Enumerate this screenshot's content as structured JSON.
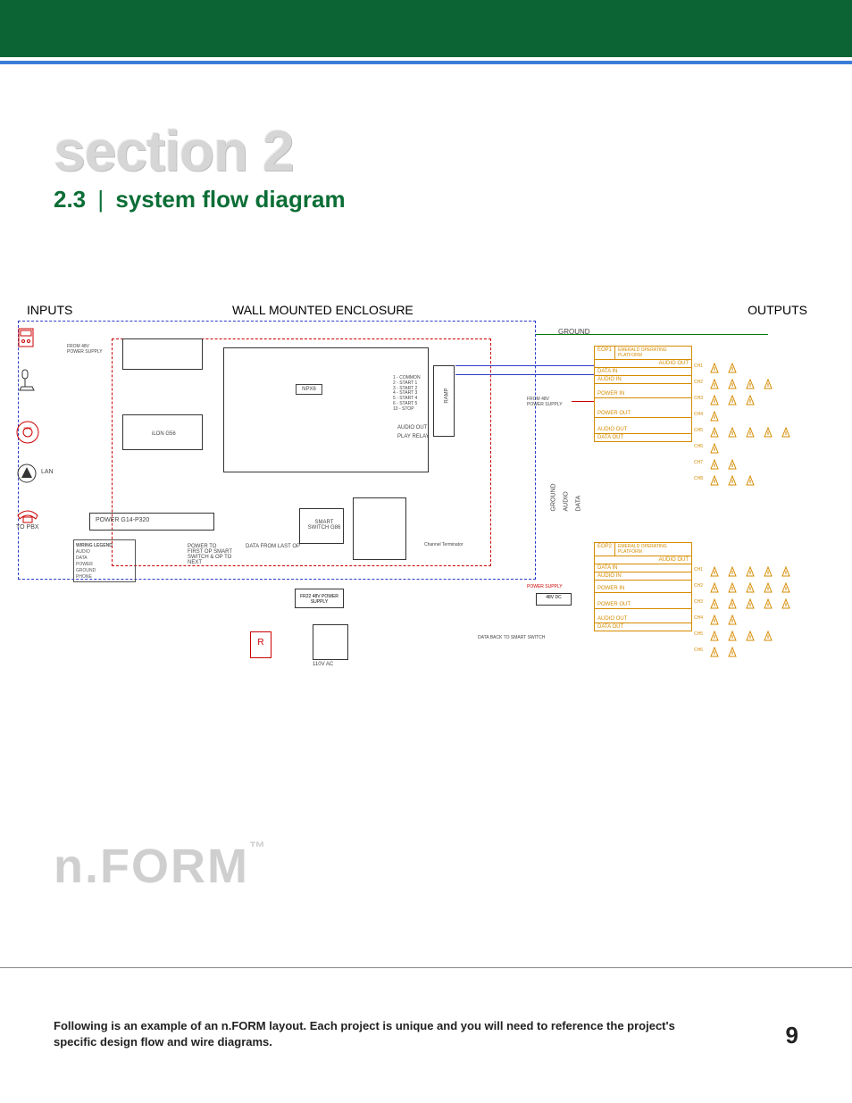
{
  "header": {
    "section_title": "section 2",
    "subsection_number": "2.3",
    "subsection_title": "system flow diagram"
  },
  "diagram": {
    "labels": {
      "inputs": "INPUTS",
      "wall": "WALL MOUNTED ENCLOSURE",
      "outputs": "OUTPUTS",
      "ground": "GROUND",
      "audio": "AUDIO",
      "data": "DATA",
      "lan": "LAN",
      "to_pbx": "TO PBX",
      "from_48v": "FROM 48V POWER SUPPLY",
      "power_g14": "POWER G14-P320",
      "ilon_g56": "iLON G56",
      "npx6": "NPX6",
      "ramp": "RAMP",
      "smart_switch": "SMART SWITCH G86",
      "relay_labels": "1 - COMMON\n2 - START 1\n3 - START 2\n4 - START 3\n5 - START 4\n6 - START 5\n10 - STOP",
      "audio_out": "AUDIO OUT",
      "play_relay": "PLAY RELAY",
      "fr22_48v": "FR22 48V POWER SUPPLY",
      "110v": "110V AC",
      "power_to_first": "POWER TO FIRST OP SMART SWITCH & OP TO NEXT",
      "data_from_last": "DATA FROM LAST OP",
      "channel_terminator": "Channel Terminator",
      "48v_dc": "48V DC",
      "power_supply": "POWER SUPPLY",
      "data_back": "DATA BACK TO SMART SWITCH",
      "from_48v_2": "FROM 48V POWER SUPPLY"
    },
    "eop": [
      {
        "title": "EOP1",
        "subtitle": "EMERALD OPERATING PLATFORM",
        "rows": [
          "AUDIO OUT",
          "DATA IN",
          "AUDIO IN",
          "POWER IN",
          "POWER OUT",
          "AUDIO OUT",
          "DATA OUT"
        ]
      },
      {
        "title": "EOP2",
        "subtitle": "EMERALD OPERATING PLATFORM",
        "rows": [
          "AUDIO OUT",
          "DATA IN",
          "AUDIO IN",
          "POWER IN",
          "POWER OUT",
          "AUDIO OUT",
          "DATA OUT"
        ]
      }
    ],
    "legend": {
      "title": "WIRING LEGEND",
      "rows": [
        "AUDIO",
        "DATA",
        "POWER",
        "GROUND",
        "PHONE"
      ]
    }
  },
  "brand": {
    "name": "n.FORM",
    "tm": "™"
  },
  "footer": {
    "note": "Following is an example of an n.FORM layout. Each project is unique and you will need to reference the project's specific design flow and wire diagrams.",
    "page": "9"
  }
}
